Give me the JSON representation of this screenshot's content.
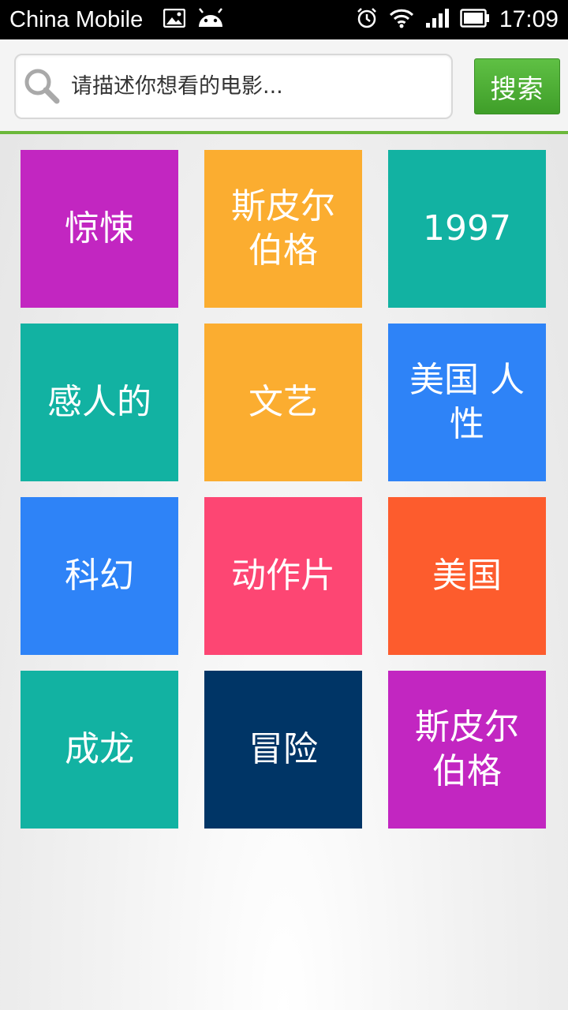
{
  "status_bar": {
    "carrier": "China Mobile",
    "time": "17:09",
    "icons": [
      "image-icon",
      "android-icon",
      "alarm-icon",
      "wifi-icon",
      "signal-icon",
      "battery-icon"
    ]
  },
  "search": {
    "placeholder": "请描述你想看的电影...",
    "button_label": "搜索"
  },
  "accent_color": "#5db33b",
  "tiles": [
    {
      "label": "惊悚",
      "color": "#c226c1"
    },
    {
      "label": "斯皮尔伯格",
      "color": "#fbad30"
    },
    {
      "label": "1997",
      "color": "#12b2a2"
    },
    {
      "label": "感人的",
      "color": "#12b2a2"
    },
    {
      "label": "文艺",
      "color": "#fbad30"
    },
    {
      "label": "美国 人性",
      "color": "#2e83f7"
    },
    {
      "label": "科幻",
      "color": "#2e83f7"
    },
    {
      "label": "动作片",
      "color": "#fd4673"
    },
    {
      "label": "美国",
      "color": "#fd5c2d"
    },
    {
      "label": "成龙",
      "color": "#12b2a2"
    },
    {
      "label": "冒险",
      "color": "#003566"
    },
    {
      "label": "斯皮尔伯格",
      "color": "#c226c1"
    }
  ]
}
